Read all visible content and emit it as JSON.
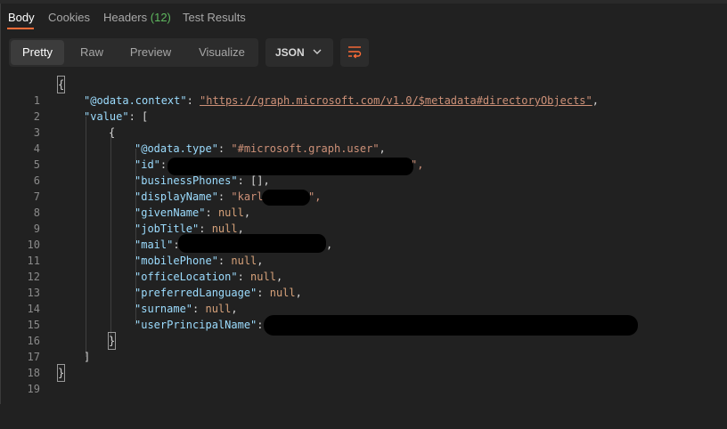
{
  "tabs": [
    {
      "label": "Body"
    },
    {
      "label": "Cookies"
    },
    {
      "label": "Headers",
      "count": "(12)"
    },
    {
      "label": "Test Results"
    }
  ],
  "view_modes": [
    "Pretty",
    "Raw",
    "Preview",
    "Visualize"
  ],
  "format": {
    "selected": "JSON"
  },
  "icons": {
    "format_dropdown": "chevron-down-icon",
    "wrap": "wrap-lines-icon"
  },
  "colors": {
    "accent": "#ff6c37",
    "key": "#9cdcfe",
    "string": "#ce9178",
    "number_null": "#d7a27a"
  },
  "code": {
    "line_numbers": [
      "1",
      "2",
      "3",
      "4",
      "5",
      "6",
      "7",
      "8",
      "9",
      "10",
      "11",
      "12",
      "13",
      "14",
      "15",
      "16",
      "17",
      "18",
      "19"
    ],
    "open_brace": "{",
    "close_brace": "}",
    "context_key": "\"@odata.context\"",
    "context_value": "\"https://graph.microsoft.com/v1.0/$metadata#directoryObjects\"",
    "value_key": "\"value\"",
    "open_bracket": "[",
    "close_bracket": "]",
    "type_key": "\"@odata.type\"",
    "type_value": "\"#microsoft.graph.user\"",
    "id_key": "\"id\"",
    "business_key": "\"businessPhones\"",
    "business_value": "[]",
    "display_key": "\"displayName\"",
    "display_value_visible": "\"karl",
    "given_key": "\"givenName\"",
    "job_key": "\"jobTitle\"",
    "mail_key": "\"mail\"",
    "mobile_key": "\"mobilePhone\"",
    "office_key": "\"officeLocation\"",
    "lang_key": "\"preferredLanguage\"",
    "surname_key": "\"surname\"",
    "upn_key": "\"userPrincipalName\"",
    "null_value": "null"
  }
}
